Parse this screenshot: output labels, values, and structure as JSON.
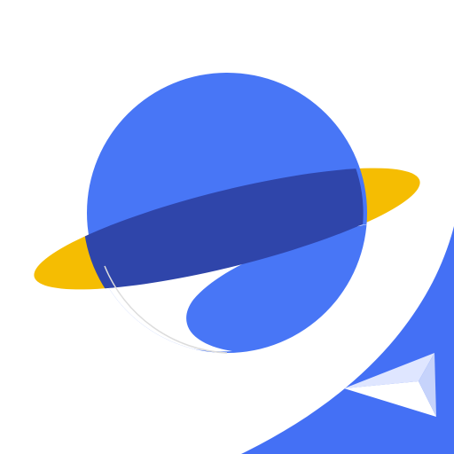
{
  "icon": {
    "name": "planet-browser-app-icon",
    "elements": [
      "planet-icon",
      "planet-ring",
      "paper-plane-icon",
      "corner-swoosh"
    ]
  },
  "colors": {
    "background": "#ffffff",
    "planet_blue": "#4876f6",
    "ring_yellow": "#f5bd02",
    "ring_overlap_navy": "#2f45aa",
    "swoosh_blue": "#4470f5",
    "plane_light": "#dfe6ff"
  }
}
